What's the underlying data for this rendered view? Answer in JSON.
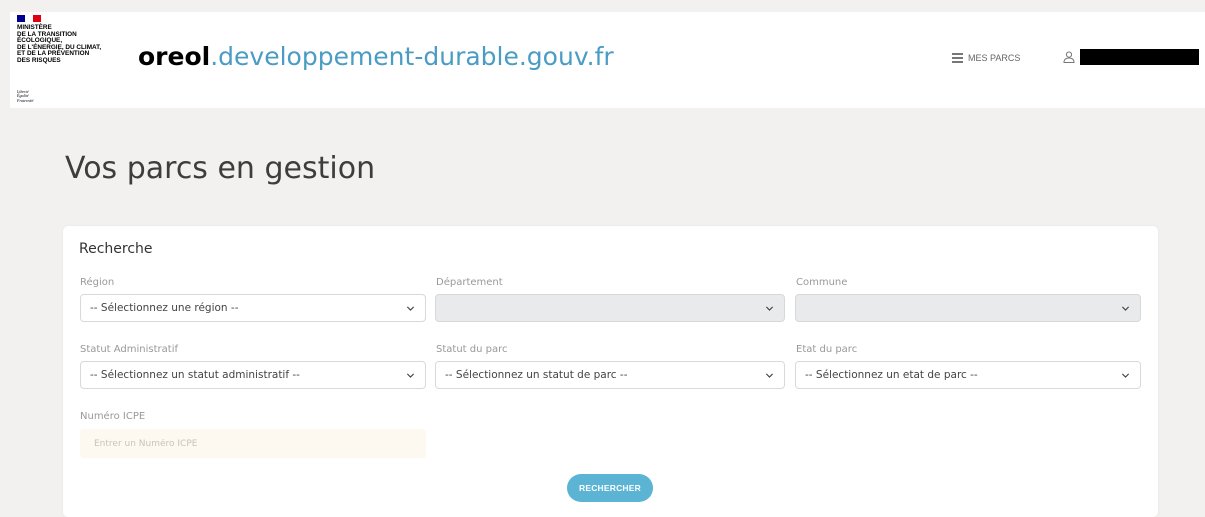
{
  "header": {
    "ministry_lines": "MINISTÈRE\nDE LA TRANSITION\nÉCOLOGIQUE,\nDE L'ÉNERGIE, DU CLIMAT,\nET DE LA PRÉVENTION\nDES RISQUES",
    "devise": "Liberté\nÉgalité\nFraternité",
    "brand": "oreol",
    "domain": ".developpement-durable.gouv.fr",
    "nav_parcs_label": "MES PARCS",
    "colors": {
      "brand": "#000000",
      "domain": "#4a9cc4",
      "flag_blue": "#000091",
      "flag_red": "#e1000f"
    }
  },
  "page": {
    "title": "Vos parcs en gestion"
  },
  "search": {
    "title": "Recherche",
    "region": {
      "label": "Région",
      "value": "-- Sélectionnez une région --"
    },
    "departement": {
      "label": "Département",
      "value": ""
    },
    "commune": {
      "label": "Commune",
      "value": ""
    },
    "statut_administratif": {
      "label": "Statut Administratif",
      "value": "-- Sélectionnez un statut administratif --"
    },
    "statut_parc": {
      "label": "Statut du parc",
      "value": "-- Sélectionnez un statut de parc --"
    },
    "etat_parc": {
      "label": "Etat du parc",
      "value": "-- Sélectionnez un etat de parc --"
    },
    "numero_icpe": {
      "label": "Numéro ICPE",
      "placeholder": "Entrer un Numéro ICPE",
      "value": ""
    },
    "button_label": "RECHERCHER",
    "button_color": "#5bb4d4"
  }
}
